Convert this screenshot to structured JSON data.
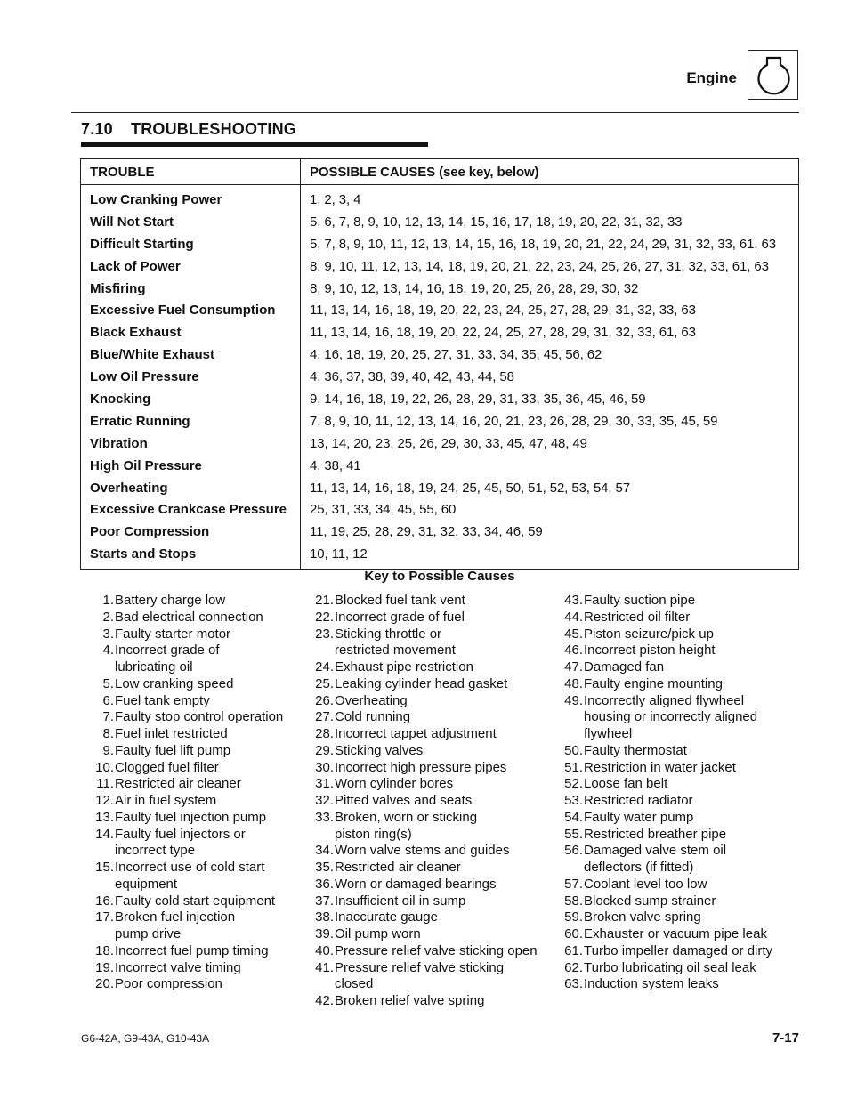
{
  "header": {
    "label": "Engine",
    "icon": "engine-icon"
  },
  "section": {
    "number": "7.10",
    "title": "TROUBLESHOOTING"
  },
  "table": {
    "headers": [
      "TROUBLE",
      "POSSIBLE CAUSES (see key, below)"
    ],
    "rows": [
      {
        "trouble": "Low Cranking Power",
        "causes": "1, 2, 3, 4"
      },
      {
        "trouble": "Will Not Start",
        "causes": "5, 6, 7, 8, 9, 10, 12, 13, 14, 15, 16, 17, 18, 19, 20, 22, 31, 32, 33"
      },
      {
        "trouble": "Difficult Starting",
        "causes": "5, 7, 8, 9, 10, 11, 12, 13, 14, 15, 16, 18, 19, 20, 21, 22, 24, 29, 31, 32, 33, 61, 63"
      },
      {
        "trouble": "Lack of Power",
        "causes": "8, 9, 10, 11, 12, 13, 14, 18, 19, 20, 21, 22, 23, 24, 25, 26, 27, 31, 32, 33, 61, 63"
      },
      {
        "trouble": "Misfiring",
        "causes": "8, 9, 10, 12, 13, 14, 16, 18, 19, 20, 25, 26, 28, 29, 30, 32"
      },
      {
        "trouble": "Excessive Fuel Consumption",
        "causes": "11, 13, 14, 16, 18, 19, 20, 22, 23, 24, 25, 27, 28, 29, 31, 32, 33, 63"
      },
      {
        "trouble": "Black Exhaust",
        "causes": "11, 13, 14, 16, 18, 19, 20, 22, 24, 25, 27, 28, 29, 31, 32, 33, 61, 63"
      },
      {
        "trouble": "Blue/White Exhaust",
        "causes": "4, 16, 18, 19, 20, 25, 27, 31, 33, 34, 35, 45, 56, 62"
      },
      {
        "trouble": "Low Oil Pressure",
        "causes": "4, 36, 37, 38, 39, 40, 42, 43, 44, 58"
      },
      {
        "trouble": "Knocking",
        "causes": "9, 14, 16, 18, 19, 22, 26, 28, 29, 31, 33, 35, 36, 45, 46, 59"
      },
      {
        "trouble": "Erratic Running",
        "causes": "7, 8, 9, 10, 11, 12, 13, 14, 16, 20, 21, 23, 26, 28, 29, 30, 33, 35, 45, 59"
      },
      {
        "trouble": "Vibration",
        "causes": "13, 14, 20, 23, 25, 26, 29, 30, 33, 45, 47, 48, 49"
      },
      {
        "trouble": "High Oil Pressure",
        "causes": "4, 38, 41"
      },
      {
        "trouble": "Overheating",
        "causes": "11, 13, 14, 16, 18, 19, 24, 25, 45, 50, 51, 52, 53, 54, 57"
      },
      {
        "trouble": "Excessive Crankcase Pressure",
        "causes": "25, 31, 33, 34, 45, 55, 60"
      },
      {
        "trouble": "Poor Compression",
        "causes": "11, 19, 25, 28, 29, 31, 32, 33, 34, 46, 59"
      },
      {
        "trouble": "Starts and Stops",
        "causes": "10, 11, 12"
      }
    ]
  },
  "key": {
    "title": "Key to Possible Causes",
    "columns": [
      [
        {
          "n": "1.",
          "lines": [
            "Battery charge low"
          ]
        },
        {
          "n": "2.",
          "lines": [
            "Bad electrical connection"
          ]
        },
        {
          "n": "3.",
          "lines": [
            "Faulty starter motor"
          ]
        },
        {
          "n": "4.",
          "lines": [
            "Incorrect grade of",
            "lubricating oil"
          ]
        },
        {
          "n": "5.",
          "lines": [
            "Low cranking speed"
          ]
        },
        {
          "n": "6.",
          "lines": [
            "Fuel tank empty"
          ]
        },
        {
          "n": "7.",
          "lines": [
            "Faulty stop control operation"
          ]
        },
        {
          "n": "8.",
          "lines": [
            "Fuel inlet restricted"
          ]
        },
        {
          "n": "9.",
          "lines": [
            "Faulty fuel lift pump"
          ]
        },
        {
          "n": "10.",
          "lines": [
            "Clogged fuel filter"
          ]
        },
        {
          "n": "11.",
          "lines": [
            "Restricted air cleaner"
          ]
        },
        {
          "n": "12.",
          "lines": [
            "Air in fuel system"
          ]
        },
        {
          "n": "13.",
          "lines": [
            "Faulty fuel injection pump"
          ]
        },
        {
          "n": "14.",
          "lines": [
            "Faulty fuel injectors or",
            "incorrect type"
          ]
        },
        {
          "n": "15.",
          "lines": [
            "Incorrect use of cold start",
            "equipment"
          ]
        },
        {
          "n": "16.",
          "lines": [
            "Faulty cold start equipment"
          ]
        },
        {
          "n": "17.",
          "lines": [
            "Broken fuel injection",
            "pump drive"
          ]
        },
        {
          "n": "18.",
          "lines": [
            "Incorrect fuel pump timing"
          ]
        },
        {
          "n": "19.",
          "lines": [
            "Incorrect valve timing"
          ]
        },
        {
          "n": "20.",
          "lines": [
            "Poor compression"
          ]
        }
      ],
      [
        {
          "n": "21.",
          "lines": [
            "Blocked fuel tank vent"
          ]
        },
        {
          "n": "22.",
          "lines": [
            "Incorrect grade of fuel"
          ]
        },
        {
          "n": "23.",
          "lines": [
            "Sticking throttle or",
            "restricted movement"
          ]
        },
        {
          "n": "24.",
          "lines": [
            "Exhaust pipe restriction"
          ]
        },
        {
          "n": "25.",
          "lines": [
            "Leaking cylinder head gasket"
          ]
        },
        {
          "n": "26.",
          "lines": [
            "Overheating"
          ]
        },
        {
          "n": "27.",
          "lines": [
            "Cold running"
          ]
        },
        {
          "n": "28.",
          "lines": [
            "Incorrect tappet adjustment"
          ]
        },
        {
          "n": "29.",
          "lines": [
            "Sticking valves"
          ]
        },
        {
          "n": "30.",
          "lines": [
            "Incorrect high pressure pipes"
          ]
        },
        {
          "n": "31.",
          "lines": [
            "Worn cylinder bores"
          ]
        },
        {
          "n": "32.",
          "lines": [
            "Pitted valves and seats"
          ]
        },
        {
          "n": "33.",
          "lines": [
            "Broken, worn or sticking",
            "piston ring(s)"
          ]
        },
        {
          "n": "34.",
          "lines": [
            "Worn valve stems and guides"
          ]
        },
        {
          "n": "35.",
          "lines": [
            "Restricted air cleaner"
          ]
        },
        {
          "n": "36.",
          "lines": [
            "Worn or damaged bearings"
          ]
        },
        {
          "n": "37.",
          "lines": [
            "Insufficient oil in sump"
          ]
        },
        {
          "n": "38.",
          "lines": [
            "Inaccurate gauge"
          ]
        },
        {
          "n": "39.",
          "lines": [
            "Oil pump worn"
          ]
        },
        {
          "n": "40.",
          "lines": [
            "Pressure relief valve sticking open"
          ]
        },
        {
          "n": "41.",
          "lines": [
            "Pressure relief valve sticking",
            "closed"
          ]
        },
        {
          "n": "42.",
          "lines": [
            "Broken relief valve spring"
          ]
        }
      ],
      [
        {
          "n": "43.",
          "lines": [
            "Faulty suction pipe"
          ]
        },
        {
          "n": "44.",
          "lines": [
            "Restricted oil filter"
          ]
        },
        {
          "n": "45.",
          "lines": [
            "Piston seizure/pick up"
          ]
        },
        {
          "n": "46.",
          "lines": [
            "Incorrect piston height"
          ]
        },
        {
          "n": "47.",
          "lines": [
            "Damaged fan"
          ]
        },
        {
          "n": "48.",
          "lines": [
            "Faulty engine mounting"
          ]
        },
        {
          "n": "49.",
          "lines": [
            "Incorrectly aligned flywheel",
            "housing or incorrectly aligned",
            "flywheel"
          ]
        },
        {
          "n": "50.",
          "lines": [
            "Faulty thermostat"
          ]
        },
        {
          "n": "51.",
          "lines": [
            "Restriction in water jacket"
          ]
        },
        {
          "n": "52.",
          "lines": [
            "Loose fan belt"
          ]
        },
        {
          "n": "53.",
          "lines": [
            "Restricted radiator"
          ]
        },
        {
          "n": "54.",
          "lines": [
            "Faulty water pump"
          ]
        },
        {
          "n": "55.",
          "lines": [
            "Restricted breather pipe"
          ]
        },
        {
          "n": "56.",
          "lines": [
            "Damaged valve stem oil",
            "deflectors (if fitted)"
          ]
        },
        {
          "n": "57.",
          "lines": [
            "Coolant level too low"
          ]
        },
        {
          "n": "58.",
          "lines": [
            "Blocked sump strainer"
          ]
        },
        {
          "n": "59.",
          "lines": [
            "Broken valve spring"
          ]
        },
        {
          "n": "60.",
          "lines": [
            "Exhauster or vacuum pipe leak"
          ]
        },
        {
          "n": "61.",
          "lines": [
            "Turbo impeller damaged or dirty"
          ]
        },
        {
          "n": "62.",
          "lines": [
            "Turbo lubricating oil seal leak"
          ]
        },
        {
          "n": "63.",
          "lines": [
            "Induction system leaks"
          ]
        }
      ]
    ]
  },
  "footer": {
    "models": "G6-42A, G9-43A, G10-43A",
    "page": "7-17"
  }
}
